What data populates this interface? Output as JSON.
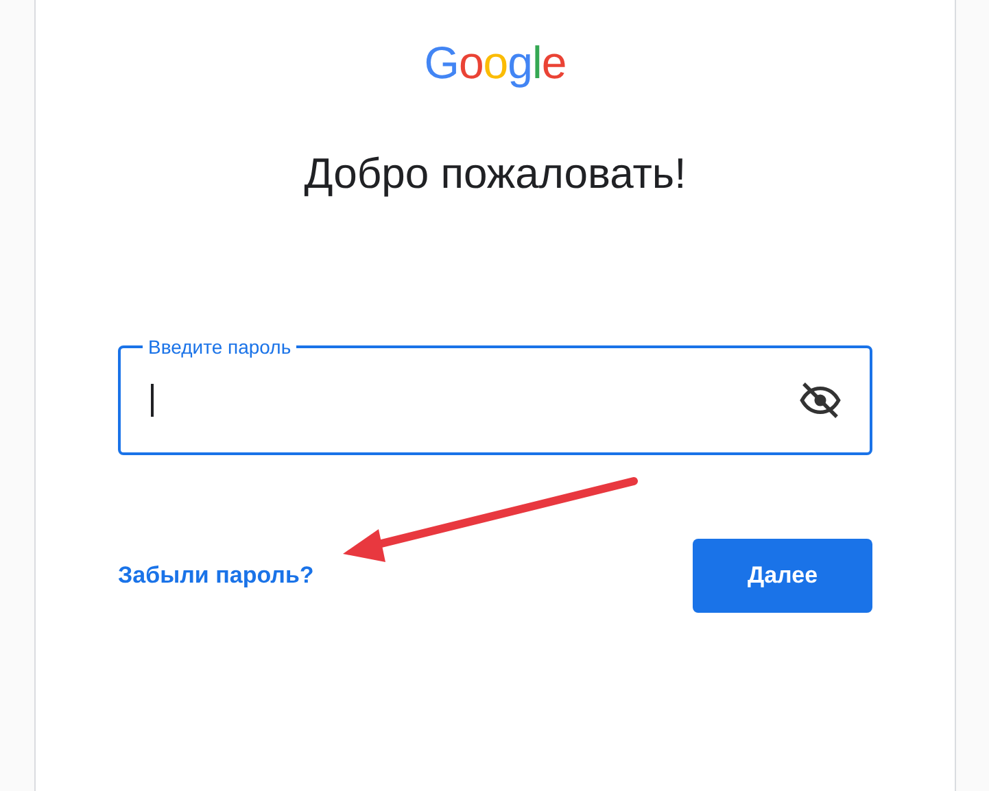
{
  "logo": "Google",
  "title": "Добро пожаловать!",
  "password_field": {
    "label": "Введите пароль",
    "focused": true,
    "password_visible": false
  },
  "forgot_link": "Забыли пароль?",
  "next_button": "Далее"
}
